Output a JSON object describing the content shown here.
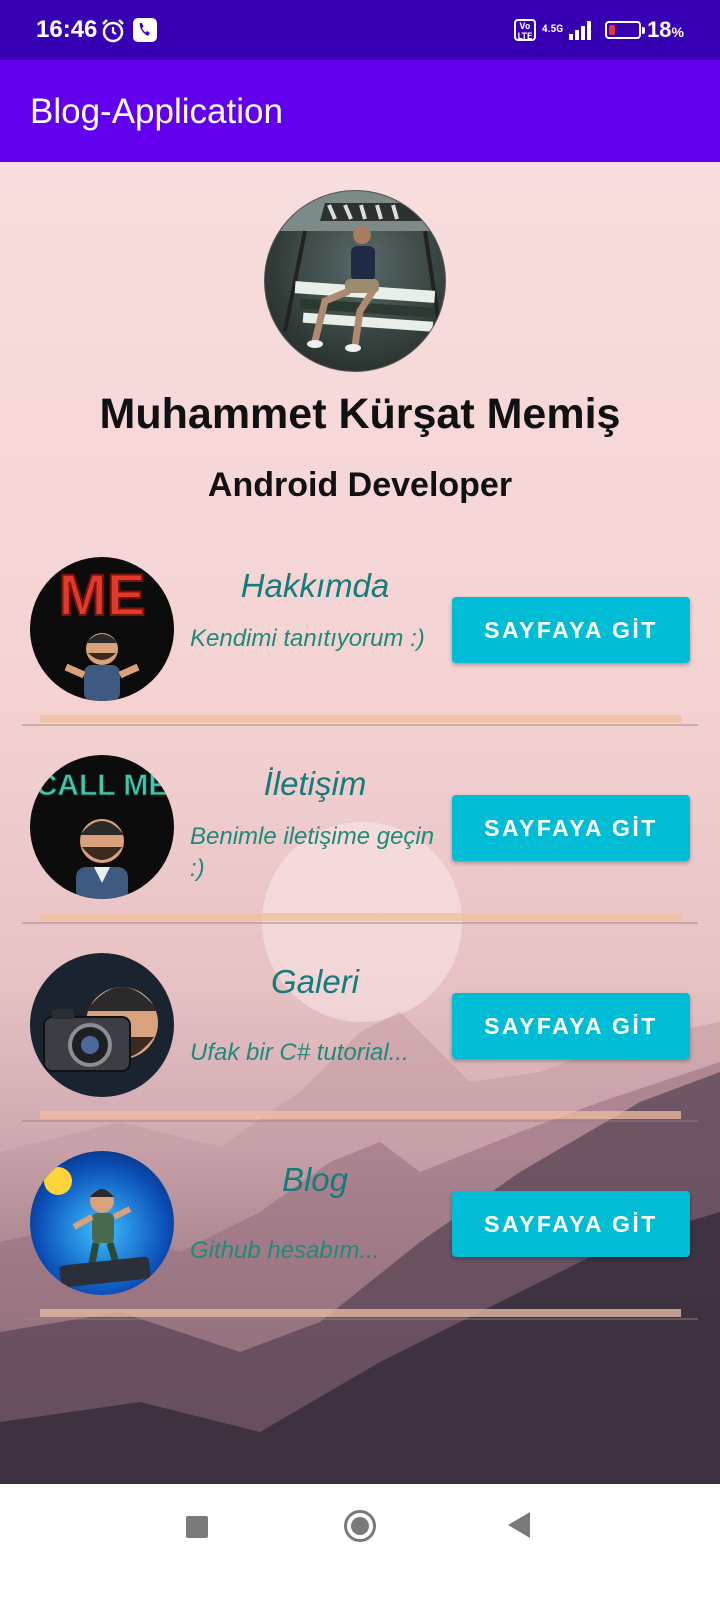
{
  "status_bar": {
    "time": "16:46",
    "volte": "Vo LTE",
    "network": "4.5G",
    "battery_percent": "18",
    "battery_suffix": "%",
    "battery_level": 0.18
  },
  "app_bar": {
    "title": "Blog-Application"
  },
  "profile": {
    "name": "Muhammet Kürşat Memiş",
    "role": "Android Developer"
  },
  "cards": [
    {
      "title": "Hakkımda",
      "description": "Kendimi tanıtıyorum :)",
      "button_label": "SAYFAYA GİT"
    },
    {
      "title": "İletişim",
      "description": "Benimle iletişime geçin :)",
      "button_label": "SAYFAYA GİT"
    },
    {
      "title": "Galeri",
      "description": "Ufak bir C# tutorial...",
      "button_label": "SAYFAYA GİT"
    },
    {
      "title": "Blog",
      "description": "Github hesabım...",
      "button_label": "SAYFAYA GİT"
    }
  ],
  "avatar_lettering": [
    "ME",
    "CALL ME"
  ],
  "colors": {
    "status_bar": "#3700b3",
    "app_bar": "#6200ee",
    "button": "#00bcd4",
    "card_title": "#157b7c"
  },
  "nav_icons": [
    "recent-apps-icon",
    "home-icon",
    "back-icon"
  ]
}
